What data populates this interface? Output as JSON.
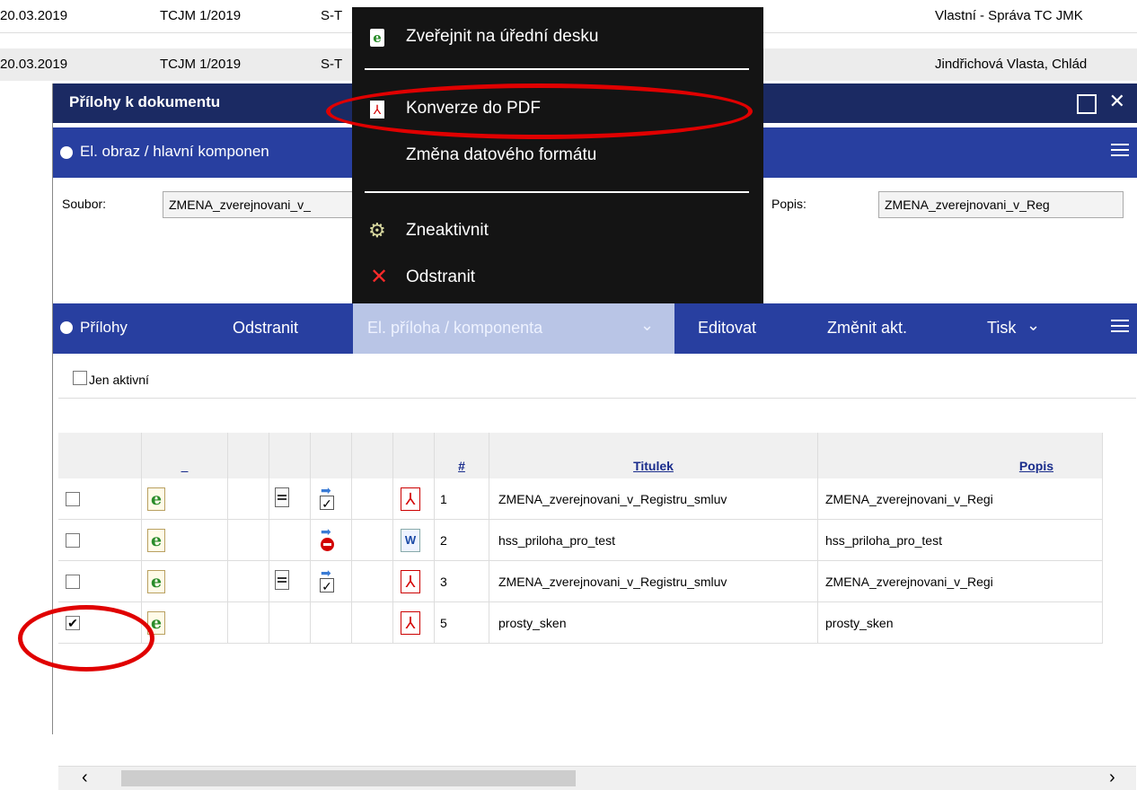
{
  "background_rows": [
    {
      "date": "20.03.2019",
      "ref": "TCJM 1/2019",
      "code": "S-T",
      "right": "Vlastní - Správa TC JMK"
    },
    {
      "date": "20.03.2019",
      "ref": "TCJM 1/2019",
      "code": "S-T",
      "right": "Jindřichová Vlasta, Chlád"
    }
  ],
  "dialog": {
    "title": "Přílohy k dokumentu",
    "section1": {
      "title": "El. obraz / hlavní komponen",
      "file_label": "Soubor:",
      "file_value": "ZMENA_zverejnovani_v_",
      "desc_label": "Popis:",
      "desc_value": "ZMENA_zverejnovani_v_Reg"
    },
    "section2": {
      "title": "Přílohy",
      "buttons": {
        "remove": "Odstranit",
        "component": "El. příloha / komponenta",
        "edit": "Editovat",
        "change_active": "Změnit akt.",
        "print": "Tisk"
      },
      "only_active_label": "Jen aktivní"
    },
    "table": {
      "headers": {
        "dash": "_",
        "num": "#",
        "title": "Titulek",
        "desc": "Popis"
      },
      "rows": [
        {
          "checked": false,
          "has_doc": true,
          "sign": "check",
          "file": "pdf",
          "num": "1",
          "title": "ZMENA_zverejnovani_v_Registru_smluv",
          "desc": "ZMENA_zverejnovani_v_Regi"
        },
        {
          "checked": false,
          "has_doc": false,
          "sign": "stop",
          "file": "word",
          "num": "2",
          "title": "hss_priloha_pro_test",
          "desc": "hss_priloha_pro_test"
        },
        {
          "checked": false,
          "has_doc": true,
          "sign": "check",
          "file": "pdf",
          "num": "3",
          "title": "ZMENA_zverejnovani_v_Registru_smluv",
          "desc": "ZMENA_zverejnovani_v_Regi"
        },
        {
          "checked": true,
          "has_doc": false,
          "sign": "none",
          "file": "pdf",
          "num": "5",
          "title": "prosty_sken",
          "desc": "prosty_sken"
        }
      ]
    }
  },
  "context_menu": {
    "publish": "Zveřejnit na úřední desku",
    "convert_pdf": "Konverze do PDF",
    "change_format": "Změna datového formátu",
    "deactivate": "Zneaktivnit",
    "remove": "Odstranit"
  },
  "colors": {
    "title_bar": "#1b2a63",
    "section_bar": "#283fa0",
    "menu_bg": "#141414",
    "annotation": "#e00000"
  }
}
